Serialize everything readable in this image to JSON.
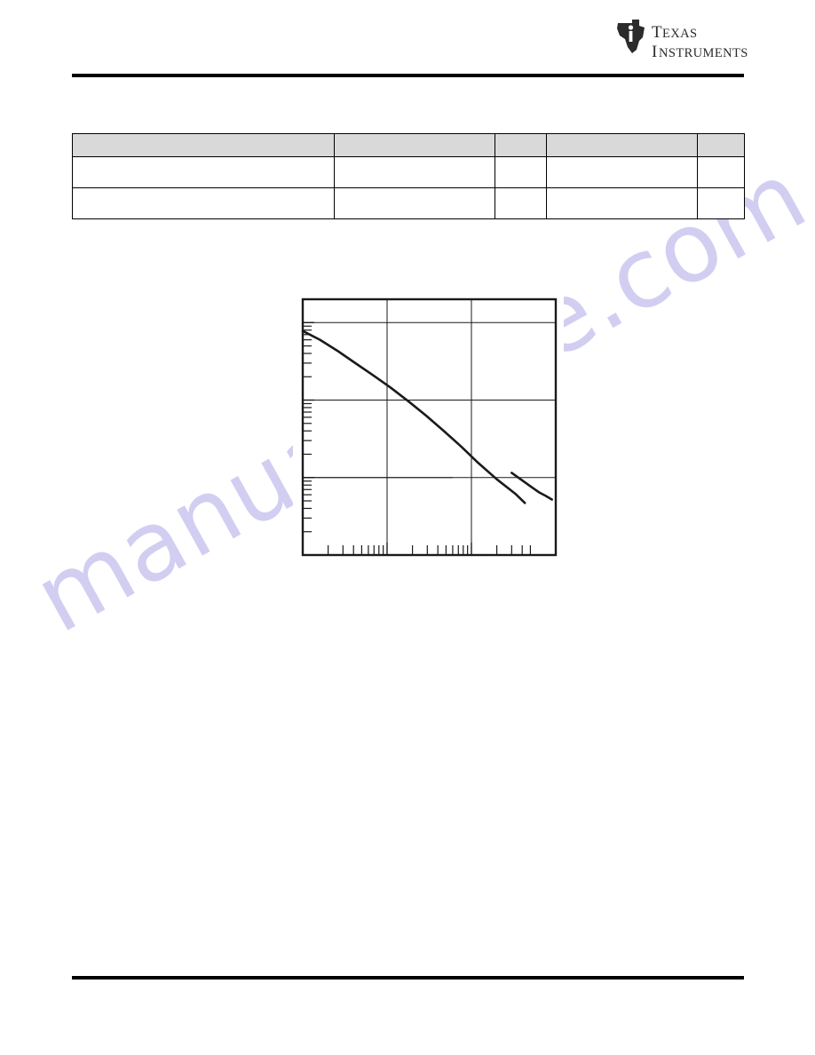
{
  "document": {
    "brand": "Texas Instruments",
    "logo_icon": "texas-instruments-logo",
    "logo_line1": "Texas",
    "logo_line2": "Instruments"
  },
  "watermark": {
    "text": "manualshive.com",
    "color": "#c9c6ef"
  },
  "section_note": "",
  "footer": {
    "left": "",
    "right": ""
  },
  "table": {
    "headers": [
      "",
      "",
      "",
      "",
      ""
    ],
    "rows": [
      [
        "",
        "",
        "",
        "",
        ""
      ],
      [
        "",
        "",
        "",
        "",
        ""
      ]
    ]
  },
  "figure": {
    "caption": "",
    "frame_color": "#1a1a1a",
    "curve_color": "#1a1a1a",
    "grid_color": "#1a1a1a"
  },
  "chart_data": {
    "type": "line",
    "title": "",
    "xlabel": "",
    "ylabel": "",
    "xscale": "log",
    "yscale": "log",
    "grid": true,
    "legend": "none",
    "xlim": [
      1,
      1000
    ],
    "ylim": [
      0.1,
      200
    ],
    "x_major_ticks": [
      1,
      10,
      100,
      1000
    ],
    "y_major_ticks": [
      0.1,
      1,
      10,
      100
    ],
    "x_minor_ticks": [
      2,
      3,
      4,
      5,
      6,
      7,
      8,
      9,
      20,
      30,
      40,
      50,
      60,
      70,
      80,
      90,
      200,
      300,
      400,
      500
    ],
    "y_minor_ticks": [
      0.2,
      0.3,
      0.4,
      0.5,
      0.6,
      0.7,
      0.8,
      0.9,
      2,
      3,
      4,
      5,
      6,
      7,
      8,
      9,
      20,
      30,
      40,
      50,
      60,
      70,
      80,
      90
    ],
    "series": [
      {
        "name": "segment-1",
        "points": [
          [
            1.0,
            78.0
          ],
          [
            1.6,
            60.0
          ],
          [
            2.6,
            43.0
          ],
          [
            4.2,
            30.0
          ],
          [
            6.8,
            21.0
          ],
          [
            11.0,
            14.5
          ],
          [
            18.0,
            9.6
          ],
          [
            29.0,
            6.3
          ],
          [
            47.0,
            4.0
          ],
          [
            76.0,
            2.5
          ],
          [
            120.0,
            1.55
          ],
          [
            200.0,
            0.95
          ],
          [
            330.0,
            0.62
          ],
          [
            430.0,
            0.47
          ]
        ]
      },
      {
        "name": "segment-2",
        "points": [
          [
            300.0,
            1.15
          ],
          [
            400.0,
            0.92
          ],
          [
            520.0,
            0.75
          ],
          [
            640.0,
            0.64
          ],
          [
            760.0,
            0.58
          ],
          [
            900.0,
            0.52
          ]
        ]
      }
    ]
  }
}
